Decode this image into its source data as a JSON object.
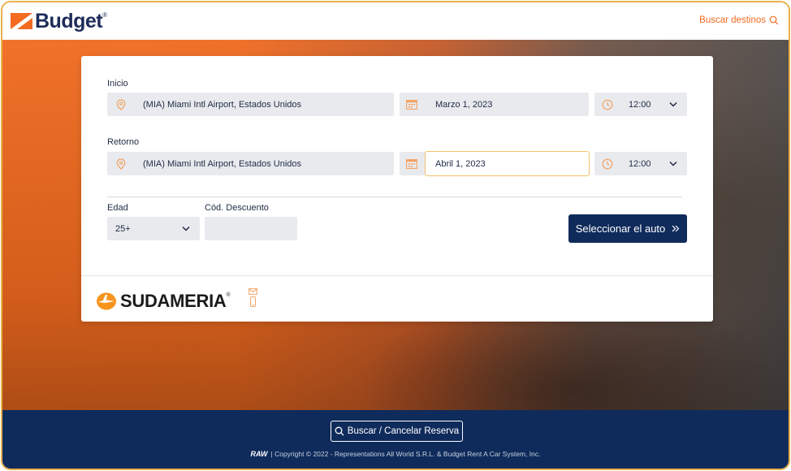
{
  "header": {
    "brand": "Budget",
    "trademark": "®",
    "search_destinations": "Buscar destinos"
  },
  "colors": {
    "brand_orange": "#f26b21",
    "brand_navy": "#0f2b5b",
    "field_bg": "#e8eaee",
    "icon_orange": "#f4a261"
  },
  "form": {
    "pickup": {
      "label": "Inicio",
      "location": "(MIA) Miami Intl Airport, Estados Unidos",
      "date": "Marzo 1, 2023",
      "time": "12:00"
    },
    "return": {
      "label": "Retorno",
      "location": "(MIA) Miami Intl Airport, Estados Unidos",
      "date": "Abril 1, 2023",
      "time": "12:00"
    },
    "age": {
      "label": "Edad",
      "value": "25+"
    },
    "discount": {
      "label": "Cód. Descuento",
      "value": ""
    },
    "submit_label": "Seleccionar el auto",
    "submit_icon": "double-chevron-right-icon"
  },
  "partner": {
    "name": "SUDAMERIA",
    "trademark": "®"
  },
  "footer": {
    "manage_booking": "Buscar / Cancelar Reserva",
    "raw_logo": "RAW",
    "copyright": "| Copyright © 2022 - Representations All World S.R.L. & Budget Rent A Car System, Inc."
  }
}
